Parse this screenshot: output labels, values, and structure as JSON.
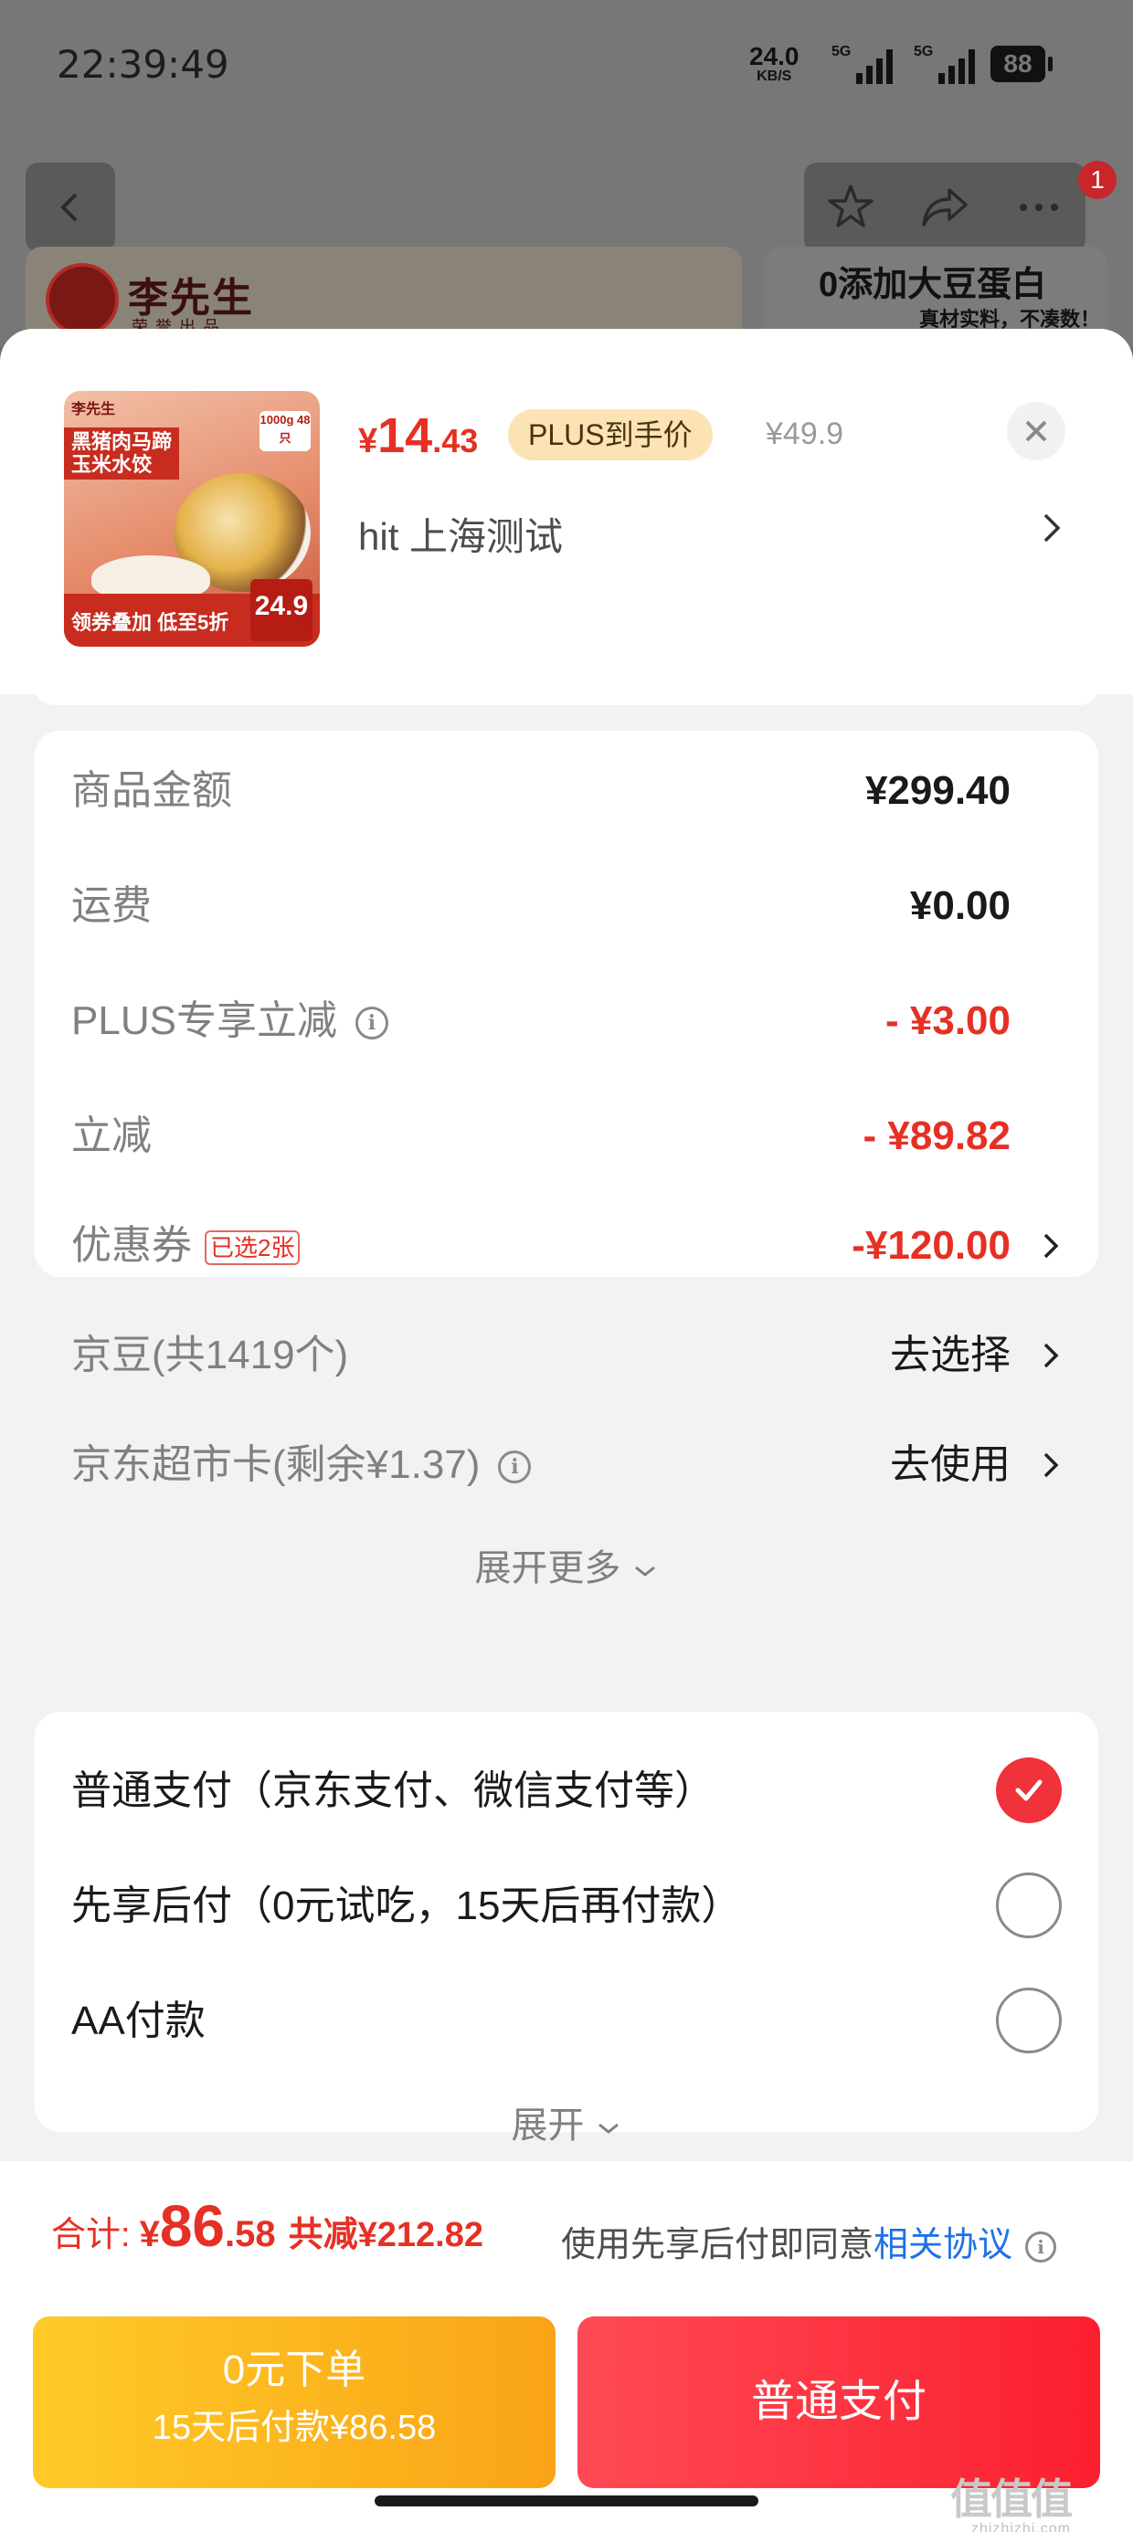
{
  "status_bar": {
    "time": "22:39:49",
    "net_speed": "24.0",
    "net_unit": "KB/S",
    "sim1": "5G",
    "sim2": "5G",
    "battery": "88"
  },
  "background": {
    "badge_count": "1",
    "brand_name": "李先生",
    "brand_sub": "荣誉出品",
    "banner_title": "0添加大豆蛋白",
    "banner_sub": "真材实料，不凑数！"
  },
  "product": {
    "thumb_title_l1": "黑猪肉马蹄",
    "thumb_title_l2": "玉米水饺",
    "thumb_promo": "领券叠加 低至5折",
    "thumb_price": "24.9",
    "thumb_weight": "1000g 48只",
    "thumb_logo": "李先生",
    "price_currency": "¥",
    "price_int": "14",
    "price_dec": ".43",
    "plus_tag": "PLUS到手价",
    "orig_price": "¥49.9",
    "address": "hit  上海测试"
  },
  "fees": {
    "items": [
      {
        "label": "商品金额",
        "value": "¥299.40"
      },
      {
        "label": "运费",
        "value": "¥0.00"
      },
      {
        "label": "PLUS专享立减",
        "value": "- ¥3.00"
      },
      {
        "label": "立减",
        "value": "- ¥89.82"
      },
      {
        "label": "优惠券",
        "tag": "已选2张",
        "value": "-¥120.00"
      },
      {
        "label": "京豆(共1419个)",
        "value": "去选择"
      },
      {
        "label": "京东超市卡(剩余¥1.37)",
        "value": "去使用"
      }
    ],
    "expand_more": "展开更多"
  },
  "payment": {
    "options": [
      {
        "label": "普通支付（京东支付、微信支付等）",
        "selected": true
      },
      {
        "label": "先享后付（0元试吃，15天后再付款）",
        "selected": false
      },
      {
        "label": "AA付款",
        "selected": false
      }
    ],
    "expand": "展开"
  },
  "footer": {
    "total_label": "合计:",
    "total_currency": "¥",
    "total_int": "86",
    "total_dec": ".58",
    "total_saved": "共减¥212.82",
    "agree_text": "使用先享后付即同意",
    "agree_link": "相关协议",
    "btn_zero_l1": "0元下单",
    "btn_zero_l2": "15天后付款¥86.58",
    "btn_pay": "普通支付",
    "watermark": "值值值",
    "watermark_url": "zhizhizhi.com"
  },
  "colors": {
    "accent_red": "#e53024",
    "link_blue": "#1e72e6",
    "plus_gold": "#fbe3b4"
  }
}
